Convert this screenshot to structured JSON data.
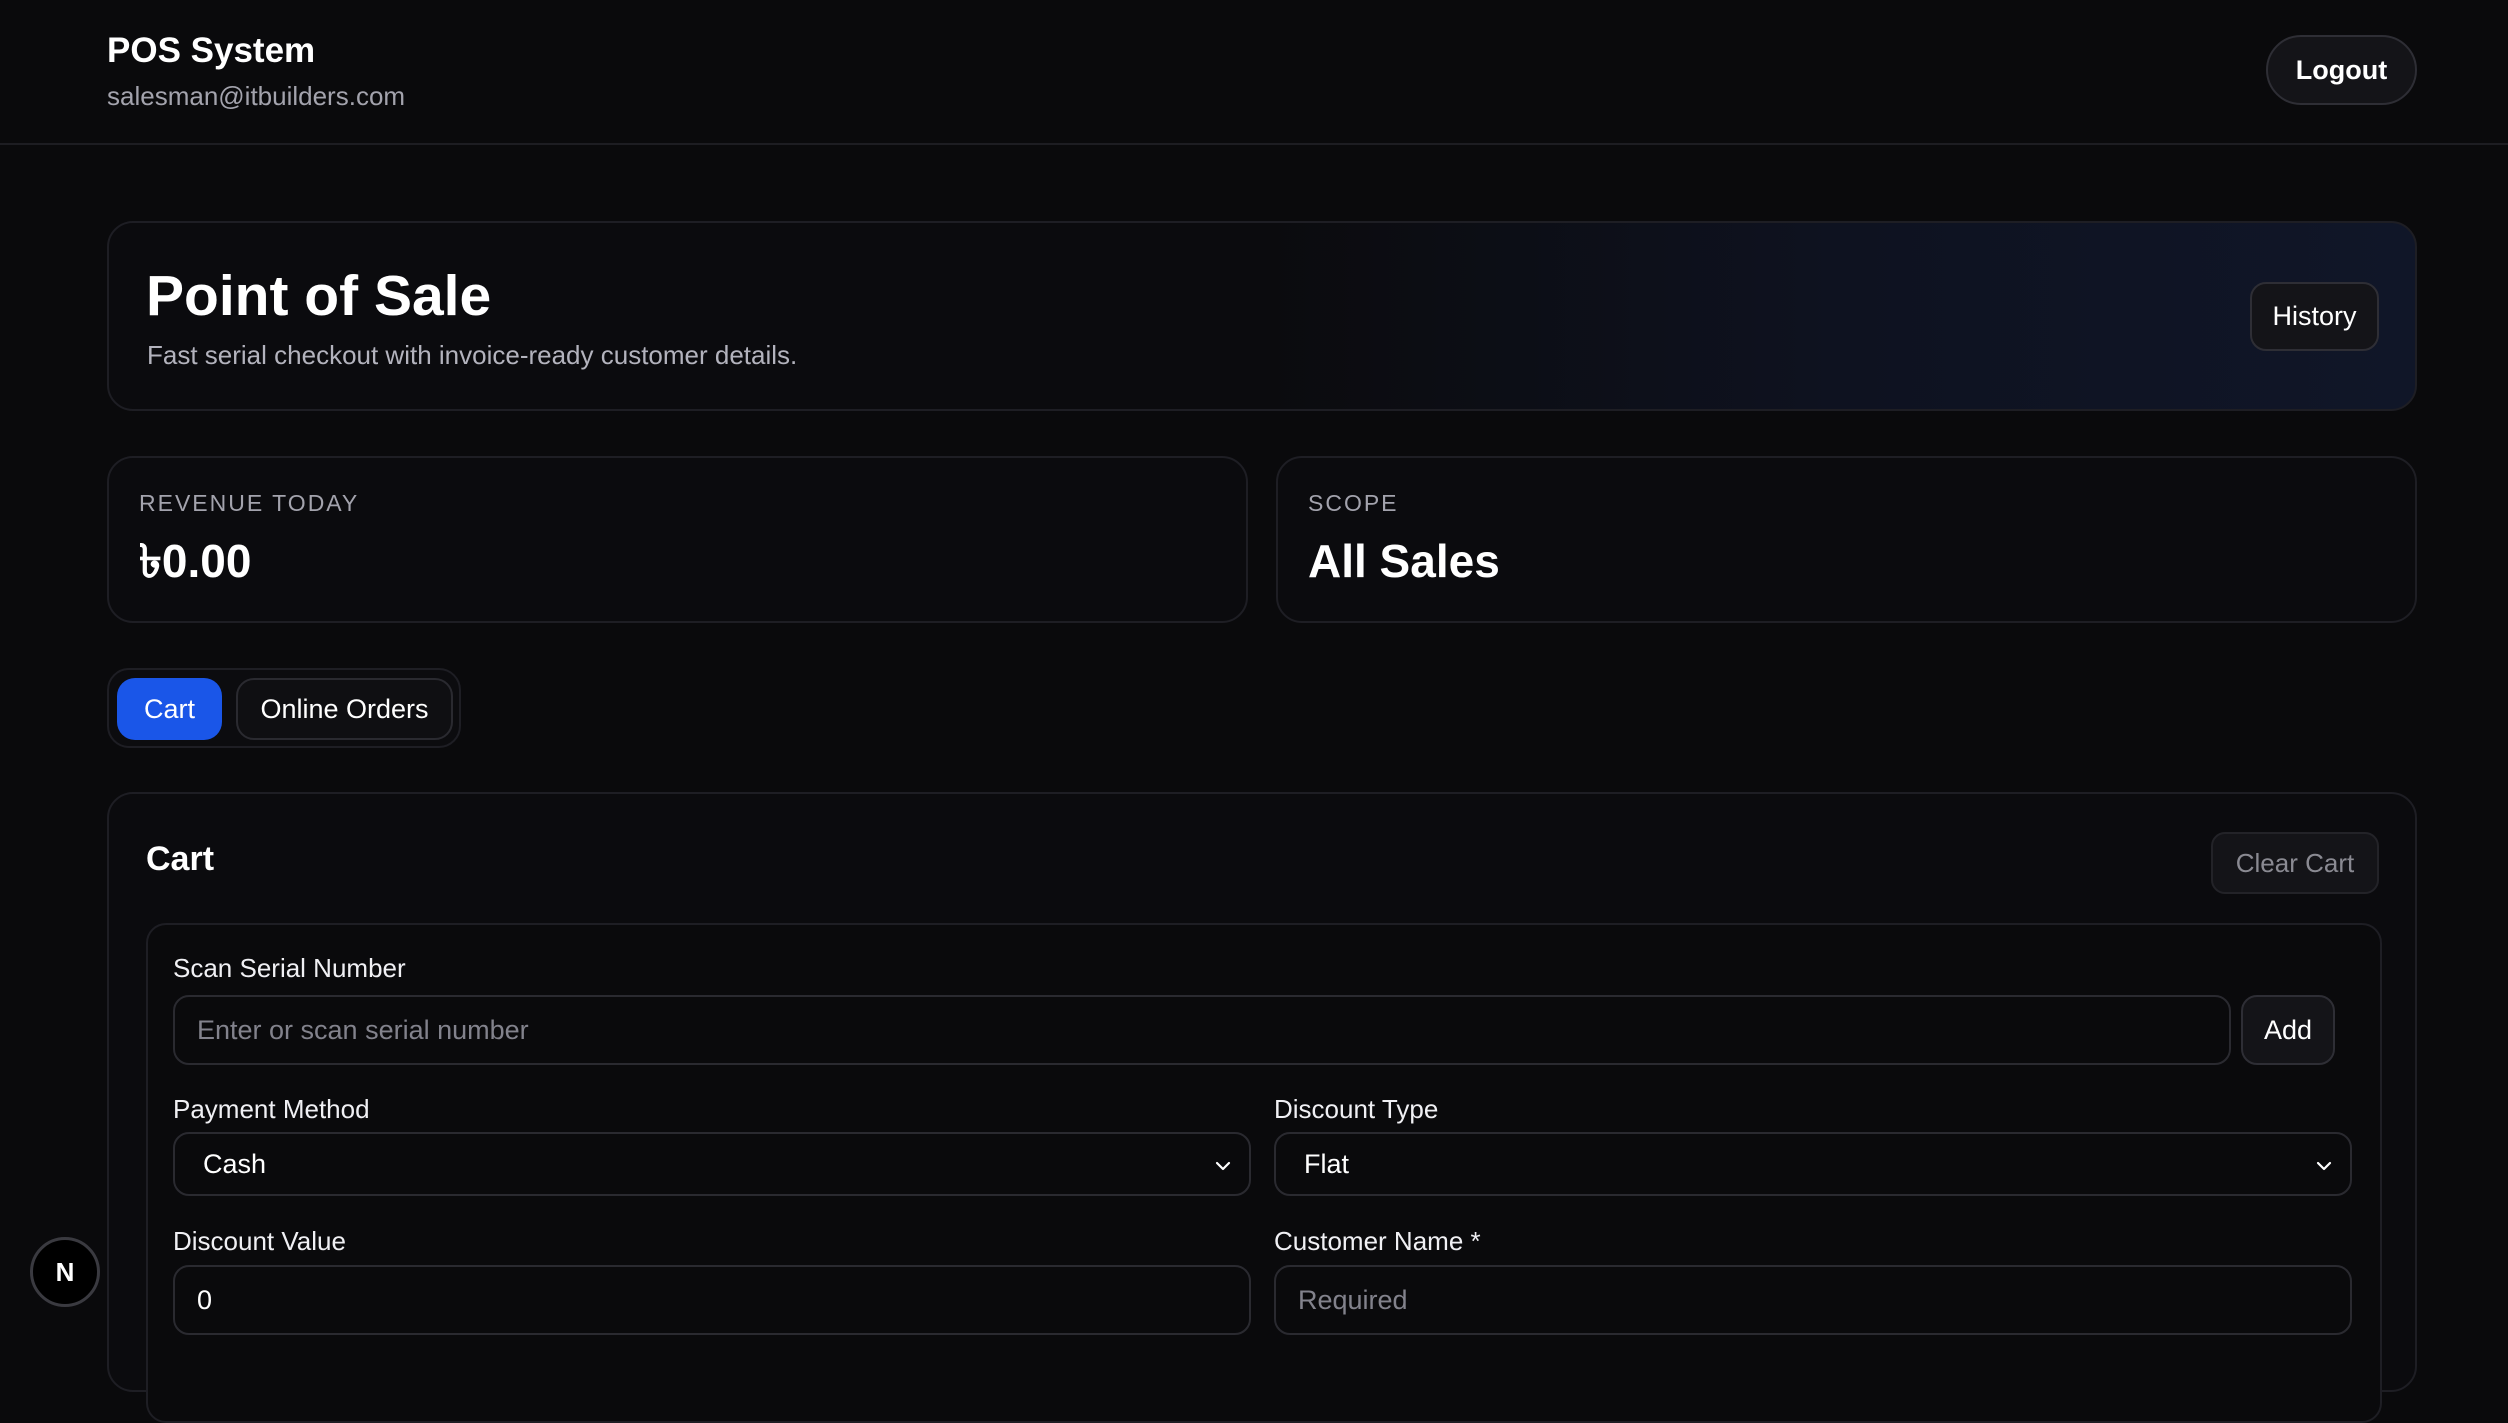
{
  "header": {
    "app_title": "POS System",
    "user_email": "salesman@itbuilders.com",
    "logout_label": "Logout"
  },
  "hero": {
    "title": "Point of Sale",
    "subtitle": "Fast serial checkout with invoice-ready customer details.",
    "history_label": "History"
  },
  "stats": {
    "revenue": {
      "label": "REVENUE TODAY",
      "value": "৳0.00"
    },
    "scope": {
      "label": "SCOPE",
      "value": "All Sales"
    }
  },
  "tabs": {
    "active": "Cart",
    "items": [
      {
        "label": "Cart"
      },
      {
        "label": "Online Orders"
      }
    ]
  },
  "cart": {
    "title": "Cart",
    "clear_label": "Clear Cart",
    "serial": {
      "label": "Scan Serial Number",
      "placeholder": "Enter or scan serial number",
      "add_label": "Add"
    },
    "payment_method": {
      "label": "Payment Method",
      "value": "Cash"
    },
    "discount_type": {
      "label": "Discount Type",
      "value": "Flat"
    },
    "discount_value": {
      "label": "Discount Value",
      "value": "0"
    },
    "customer_name": {
      "label": "Customer Name *",
      "placeholder": "Required"
    }
  },
  "badge": {
    "letter": "N"
  },
  "colors": {
    "background": "#0a0a0c",
    "accent": "#1a56e8",
    "border": "#1e1e24",
    "muted_text": "#a3a3ad"
  }
}
